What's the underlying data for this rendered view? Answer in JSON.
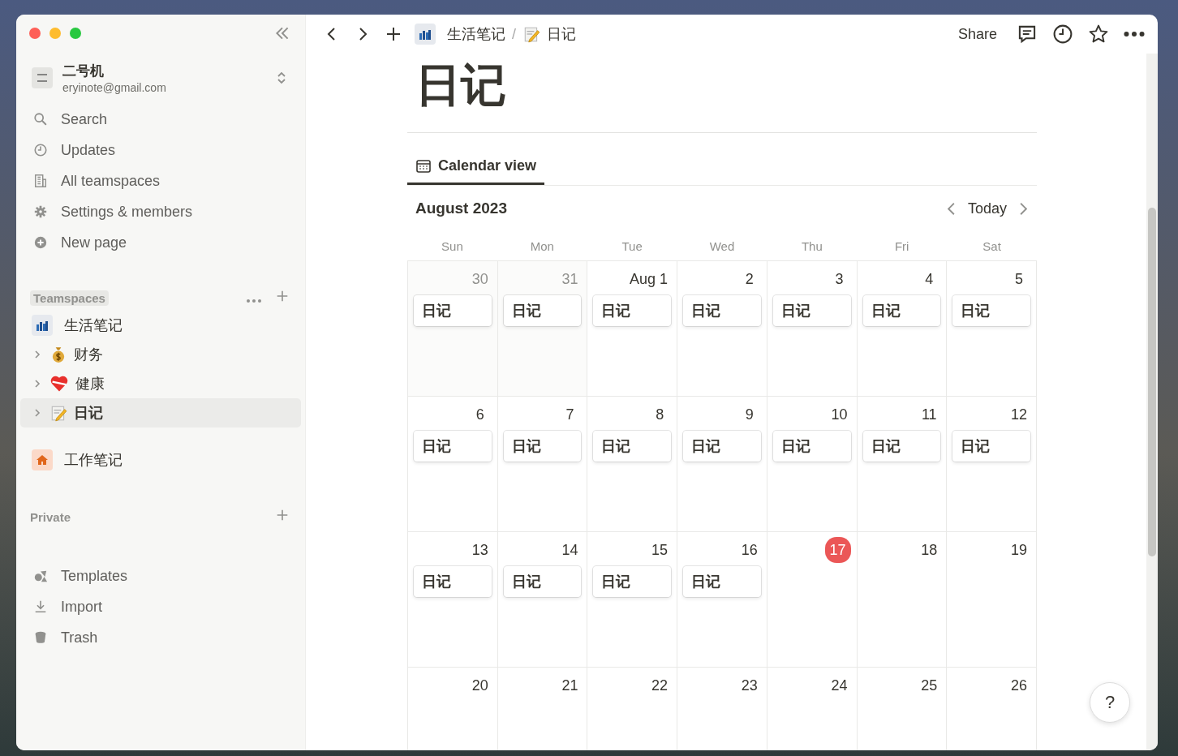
{
  "workspace": {
    "name": "二号机",
    "email": "eryinote@gmail.com"
  },
  "sidebar_nav": [
    {
      "label": "Search"
    },
    {
      "label": "Updates"
    },
    {
      "label": "All teamspaces"
    },
    {
      "label": "Settings & members"
    },
    {
      "label": "New page"
    }
  ],
  "teamspaces": {
    "title": "Teamspaces",
    "items": [
      {
        "label": "生活笔记",
        "children": [
          {
            "label": "财务",
            "expanded": false,
            "selected": false
          },
          {
            "label": "健康",
            "expanded": false,
            "selected": false
          },
          {
            "label": "日记",
            "expanded": false,
            "selected": true
          }
        ]
      },
      {
        "label": "工作笔记"
      }
    ]
  },
  "private": {
    "title": "Private"
  },
  "sidebar_footer": [
    {
      "label": "Templates"
    },
    {
      "label": "Import"
    },
    {
      "label": "Trash"
    }
  ],
  "breadcrumb": [
    {
      "label": "生活笔记"
    },
    {
      "label": "日记"
    }
  ],
  "breadcrumb_separator": "/",
  "topbar": {
    "share": "Share"
  },
  "page": {
    "title": "日记"
  },
  "view_tabs": [
    {
      "label": "Calendar view",
      "selected": true
    }
  ],
  "calendar": {
    "month": "August 2023",
    "today_button": "Today",
    "weekdays": [
      "Sun",
      "Mon",
      "Tue",
      "Wed",
      "Thu",
      "Fri",
      "Sat"
    ],
    "weeks": [
      [
        {
          "day": "30",
          "in_month": false,
          "today": false,
          "entries": [
            "日记"
          ]
        },
        {
          "day": "31",
          "in_month": false,
          "today": false,
          "entries": [
            "日记"
          ]
        },
        {
          "day": "Aug 1",
          "in_month": true,
          "today": false,
          "entries": [
            "日记"
          ]
        },
        {
          "day": "2",
          "in_month": true,
          "today": false,
          "entries": [
            "日记"
          ]
        },
        {
          "day": "3",
          "in_month": true,
          "today": false,
          "entries": [
            "日记"
          ]
        },
        {
          "day": "4",
          "in_month": true,
          "today": false,
          "entries": [
            "日记"
          ]
        },
        {
          "day": "5",
          "in_month": true,
          "today": false,
          "entries": [
            "日记"
          ]
        }
      ],
      [
        {
          "day": "6",
          "in_month": true,
          "today": false,
          "entries": [
            "日记"
          ]
        },
        {
          "day": "7",
          "in_month": true,
          "today": false,
          "entries": [
            "日记"
          ]
        },
        {
          "day": "8",
          "in_month": true,
          "today": false,
          "entries": [
            "日记"
          ]
        },
        {
          "day": "9",
          "in_month": true,
          "today": false,
          "entries": [
            "日记"
          ]
        },
        {
          "day": "10",
          "in_month": true,
          "today": false,
          "entries": [
            "日记"
          ]
        },
        {
          "day": "11",
          "in_month": true,
          "today": false,
          "entries": [
            "日记"
          ]
        },
        {
          "day": "12",
          "in_month": true,
          "today": false,
          "entries": [
            "日记"
          ]
        }
      ],
      [
        {
          "day": "13",
          "in_month": true,
          "today": false,
          "entries": [
            "日记"
          ]
        },
        {
          "day": "14",
          "in_month": true,
          "today": false,
          "entries": [
            "日记"
          ]
        },
        {
          "day": "15",
          "in_month": true,
          "today": false,
          "entries": [
            "日记"
          ]
        },
        {
          "day": "16",
          "in_month": true,
          "today": false,
          "entries": [
            "日记"
          ]
        },
        {
          "day": "17",
          "in_month": true,
          "today": true
        },
        {
          "day": "18",
          "in_month": true,
          "today": false
        },
        {
          "day": "19",
          "in_month": true,
          "today": false
        }
      ],
      [
        {
          "day": "20",
          "in_month": true,
          "today": false
        },
        {
          "day": "21",
          "in_month": true,
          "today": false
        },
        {
          "day": "22",
          "in_month": true,
          "today": false
        },
        {
          "day": "23",
          "in_month": true,
          "today": false
        },
        {
          "day": "24",
          "in_month": true,
          "today": false
        },
        {
          "day": "25",
          "in_month": true,
          "today": false
        },
        {
          "day": "26",
          "in_month": true,
          "today": false
        }
      ]
    ]
  },
  "help_button": "?"
}
